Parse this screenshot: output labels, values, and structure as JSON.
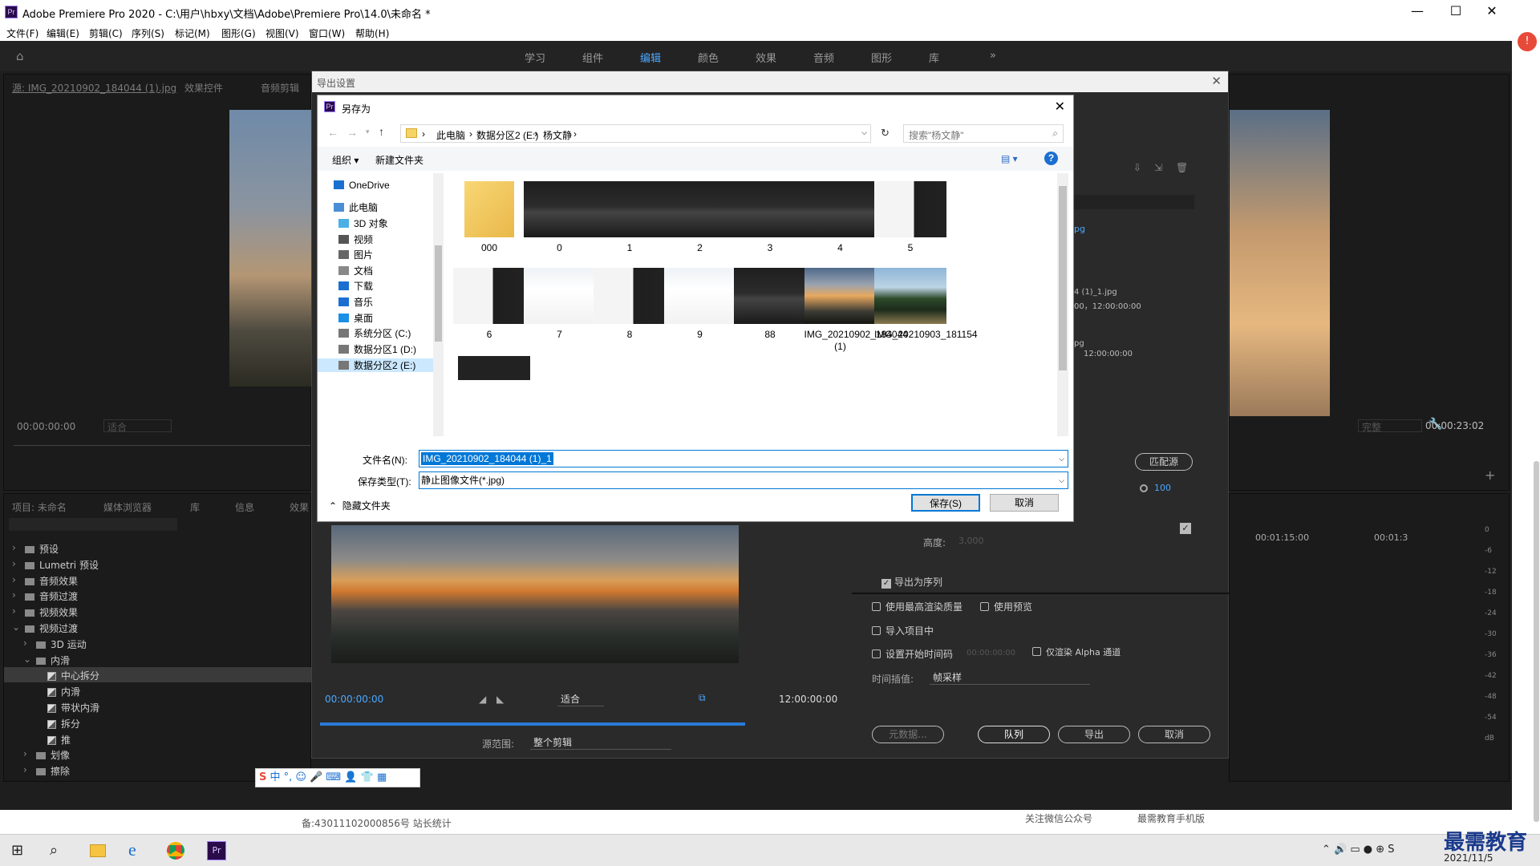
{
  "window": {
    "title": "Adobe Premiere Pro 2020 - C:\\用户\\hbxy\\文档\\Adobe\\Premiere Pro\\14.0\\未命名 *",
    "logo": "Pr",
    "minimize": "—",
    "maximize": "☐",
    "close": "✕"
  },
  "menu": [
    "文件(F)",
    "编辑(E)",
    "剪辑(C)",
    "序列(S)",
    "标记(M)",
    "图形(G)",
    "视图(V)",
    "窗口(W)",
    "帮助(H)"
  ],
  "workspaces": [
    "学习",
    "组件",
    "编辑",
    "颜色",
    "效果",
    "音频",
    "图形",
    "库"
  ],
  "workspace_more": "»",
  "active_workspace": "编辑",
  "source_panel": {
    "tabs": [
      "源: IMG_20210902_184044 (1).jpg",
      "效果控件",
      "音频剪辑"
    ],
    "timecode": "00:00:00:00",
    "fit": "适合"
  },
  "program_panel": {
    "timecode_end": "00:00:23:02",
    "fit": "完整"
  },
  "project_panel": {
    "tabs": [
      "项目: 未命名",
      "媒体浏览器",
      "库",
      "信息",
      "效果"
    ],
    "tree": [
      {
        "label": "预设",
        "level": 0
      },
      {
        "label": "Lumetri 预设",
        "level": 0
      },
      {
        "label": "音频效果",
        "level": 0
      },
      {
        "label": "音频过渡",
        "level": 0
      },
      {
        "label": "视频效果",
        "level": 0
      },
      {
        "label": "视频过渡",
        "level": 0,
        "open": true
      },
      {
        "label": "3D 运动",
        "level": 1
      },
      {
        "label": "内滑",
        "level": 1,
        "open": true
      },
      {
        "label": "中心拆分",
        "level": 2,
        "selected": true
      },
      {
        "label": "内滑",
        "level": 2
      },
      {
        "label": "带状内滑",
        "level": 2
      },
      {
        "label": "拆分",
        "level": 2
      },
      {
        "label": "推",
        "level": 2
      },
      {
        "label": "划像",
        "level": 1
      },
      {
        "label": "擦除",
        "level": 1
      }
    ]
  },
  "export_dialog": {
    "title": "导出设置",
    "timecode_start": "00:00:00:00",
    "timecode_end": "12:00:00:00",
    "fit": "适合",
    "source_range_label": "源范围:",
    "source_range": "整个剪辑",
    "right": {
      "match_source": "匹配源",
      "width_val": "100",
      "height_label": "高度:",
      "height_val": "3,000",
      "export_as_sequence": "导出为序列",
      "file_line1": "4 (1)_1.jpg",
      "file_line1b": "00，12:00:00:00",
      "file_line2": "pg",
      "file_line2b": "12:00:00:00",
      "link": "pg",
      "max_quality": "使用最高渲染质量",
      "use_preview": "使用预览",
      "import_project": "导入项目中",
      "set_start_tc": "设置开始时间码",
      "start_tc": "00:00:00:00",
      "alpha_only": "仅渲染 Alpha 通道",
      "interp_label": "时间插值:",
      "interp": "帧采样",
      "metadata": "元数据...",
      "queue": "队列",
      "export": "导出",
      "cancel": "取消"
    }
  },
  "timeline": {
    "tc1": "00:01:15:00",
    "tc2": "00:01:3"
  },
  "audio_meter": [
    "0",
    "-6",
    "-12",
    "-18",
    "-24",
    "-30",
    "-36",
    "-42",
    "-48",
    "-54",
    "dB"
  ],
  "saveas": {
    "title": "另存为",
    "logo": "Pr",
    "breadcrumb": [
      "此电脑",
      "数据分区2 (E:)",
      "杨文静"
    ],
    "search_placeholder": "搜索\"杨文静\"",
    "organize": "组织 ▾",
    "new_folder": "新建文件夹",
    "help": "?",
    "nav": [
      {
        "label": "OneDrive",
        "icon": "cloud-icon"
      },
      {
        "label": "此电脑",
        "icon": "computer-icon"
      },
      {
        "label": "3D 对象",
        "icon": "3d-objects-icon"
      },
      {
        "label": "视频",
        "icon": "video-icon"
      },
      {
        "label": "图片",
        "icon": "pictures-icon"
      },
      {
        "label": "文档",
        "icon": "documents-icon"
      },
      {
        "label": "下载",
        "icon": "download-icon"
      },
      {
        "label": "音乐",
        "icon": "music-icon"
      },
      {
        "label": "桌面",
        "icon": "desktop-icon"
      },
      {
        "label": "系统分区 (C:)",
        "icon": "drive-icon"
      },
      {
        "label": "数据分区1 (D:)",
        "icon": "drive-icon"
      },
      {
        "label": "数据分区2 (E:)",
        "icon": "drive-icon",
        "selected": true
      }
    ],
    "files": [
      {
        "name": "000",
        "kind": "folder"
      },
      {
        "name": "0",
        "kind": "dark"
      },
      {
        "name": "1",
        "kind": "dark"
      },
      {
        "name": "2",
        "kind": "dark"
      },
      {
        "name": "3",
        "kind": "dark"
      },
      {
        "name": "4",
        "kind": "dark"
      },
      {
        "name": "5",
        "kind": "light"
      },
      {
        "name": "6",
        "kind": "light"
      },
      {
        "name": "7",
        "kind": "white"
      },
      {
        "name": "8",
        "kind": "light"
      },
      {
        "name": "9",
        "kind": "white"
      },
      {
        "name": "88",
        "kind": "dark"
      },
      {
        "name": "IMG_20210902_184044 (1)",
        "kind": "sunset"
      },
      {
        "name": "IMG_20210903_181154",
        "kind": "palm"
      }
    ],
    "filename_label": "文件名(N):",
    "filename": "IMG_20210902_184044 (1)_1",
    "filetype_label": "保存类型(T):",
    "filetype": "静止图像文件(*.jpg)",
    "hide_folders": "隐藏文件夹",
    "save": "保存(S)",
    "cancel": "取消"
  },
  "bottom": {
    "icp": "备:43011102000856号  站长统计",
    "wechat": "关注微信公众号",
    "app": "最需教育手机版"
  },
  "watermark": "最需教育",
  "taskbar": {
    "date": "2021/11/5"
  },
  "colors": {
    "accent": "#4aa8ff",
    "pr_purple": "#2a0b4a",
    "selection": "#0078d7"
  }
}
